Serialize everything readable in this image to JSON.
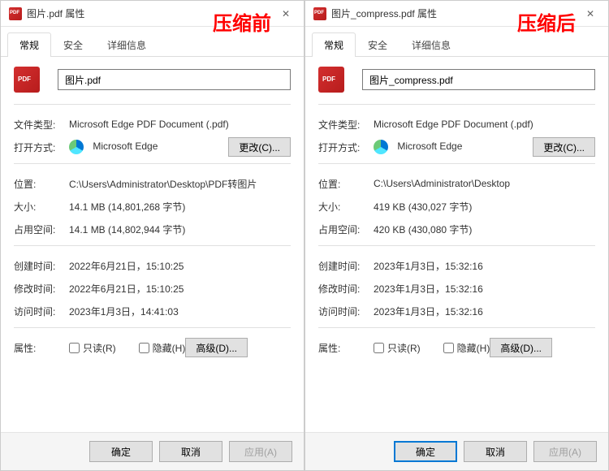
{
  "left": {
    "heading": "压缩前",
    "title": "图片.pdf 属性",
    "tabs": [
      "常规",
      "安全",
      "详细信息"
    ],
    "filename": "图片.pdf",
    "labels": {
      "filetype": "文件类型:",
      "openwith": "打开方式:",
      "location": "位置:",
      "size": "大小:",
      "sizeondisk": "占用空间:",
      "created": "创建时间:",
      "modified": "修改时间:",
      "accessed": "访问时间:",
      "attributes": "属性:"
    },
    "values": {
      "filetype": "Microsoft Edge PDF Document (.pdf)",
      "openapp": "Microsoft Edge",
      "location": "C:\\Users\\Administrator\\Desktop\\PDF转图片",
      "size": "14.1 MB (14,801,268 字节)",
      "sizeondisk": "14.1 MB (14,802,944 字节)",
      "created": "2022年6月21日，15:10:25",
      "modified": "2022年6月21日，15:10:25",
      "accessed": "2023年1月3日，14:41:03"
    },
    "buttons": {
      "change": "更改(C)...",
      "advanced": "高级(D)...",
      "readonly": "只读(R)",
      "hidden": "隐藏(H)",
      "ok": "确定",
      "cancel": "取消",
      "apply": "应用(A)"
    }
  },
  "right": {
    "heading": "压缩后",
    "title": "图片_compress.pdf 属性",
    "tabs": [
      "常规",
      "安全",
      "详细信息"
    ],
    "filename": "图片_compress.pdf",
    "labels": {
      "filetype": "文件类型:",
      "openwith": "打开方式:",
      "location": "位置:",
      "size": "大小:",
      "sizeondisk": "占用空间:",
      "created": "创建时间:",
      "modified": "修改时间:",
      "accessed": "访问时间:",
      "attributes": "属性:"
    },
    "values": {
      "filetype": "Microsoft Edge PDF Document (.pdf)",
      "openapp": "Microsoft Edge",
      "location": "C:\\Users\\Administrator\\Desktop",
      "size": "419 KB (430,027 字节)",
      "sizeondisk": "420 KB (430,080 字节)",
      "created": "2023年1月3日，15:32:16",
      "modified": "2023年1月3日，15:32:16",
      "accessed": "2023年1月3日，15:32:16"
    },
    "buttons": {
      "change": "更改(C)...",
      "advanced": "高级(D)...",
      "readonly": "只读(R)",
      "hidden": "隐藏(H)",
      "ok": "确定",
      "cancel": "取消",
      "apply": "应用(A)"
    }
  }
}
